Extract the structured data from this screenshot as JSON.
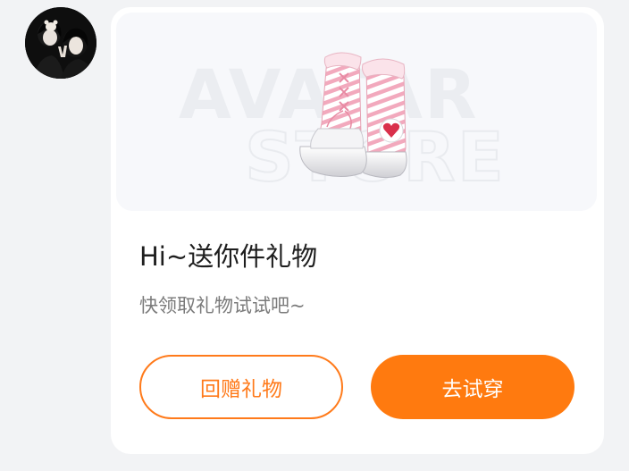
{
  "sender": {
    "avatar_icon": "user-avatar-photo"
  },
  "gift_card": {
    "watermark_line1": "AVATAR",
    "watermark_line2": "STORE",
    "product_icon": "pink-striped-boots",
    "title": "Hi~送你件礼物",
    "subtitle": "快领取礼物试试吧~",
    "actions": {
      "return_gift_label": "回赠礼物",
      "try_on_label": "去试穿"
    }
  },
  "colors": {
    "accent": "#ff7a0f",
    "background": "#f2f3f5",
    "card": "#ffffff"
  }
}
